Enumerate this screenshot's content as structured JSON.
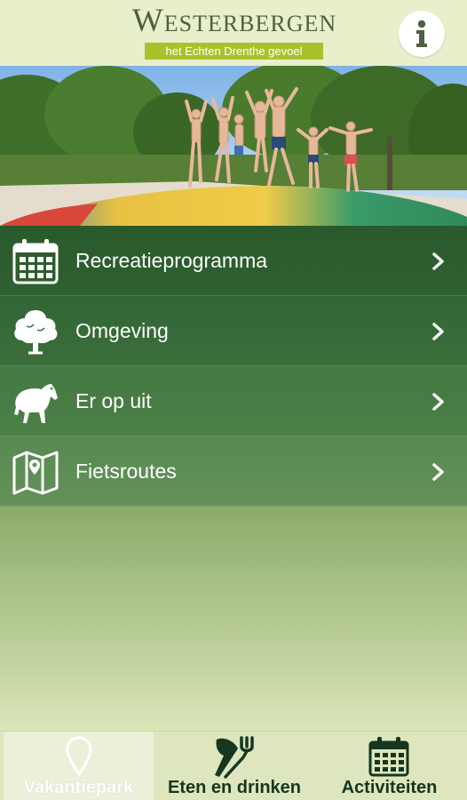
{
  "header": {
    "logo_title": "Westerbergen",
    "logo_subtitle": "het Echten Drenthe gevoel",
    "info_icon": "info-icon"
  },
  "colors": {
    "menu_green_top": "#2c5a2c",
    "menu_green_bottom": "#7ea260",
    "subtitle_bg": "#a9c22c",
    "tab_text": "#16361f"
  },
  "menu": {
    "items": [
      {
        "label": "Recreatieprogramma",
        "icon": "calendar-icon"
      },
      {
        "label": "Omgeving",
        "icon": "tree-icon"
      },
      {
        "label": "Er op uit",
        "icon": "horse-icon"
      },
      {
        "label": "Fietsroutes",
        "icon": "map-icon"
      }
    ]
  },
  "tabs": [
    {
      "label": "Vakantiepark",
      "icon": "location-pin-icon",
      "active": true
    },
    {
      "label": "Eten en drinken",
      "icon": "fork-knife-icon",
      "active": false
    },
    {
      "label": "Activiteiten",
      "icon": "calendar-icon",
      "active": false
    }
  ]
}
